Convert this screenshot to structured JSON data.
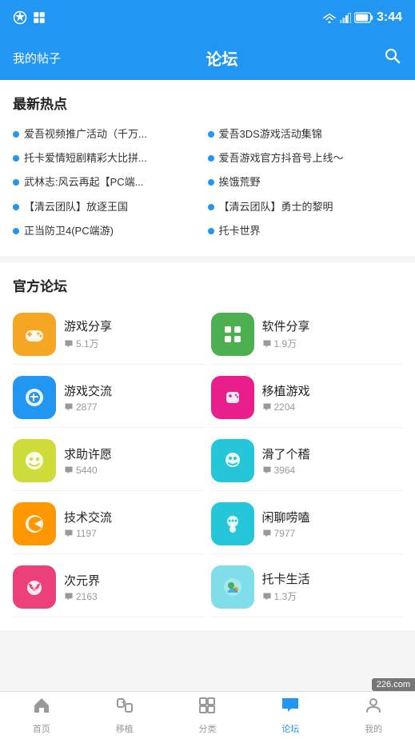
{
  "statusBar": {
    "time": "3:44",
    "icons": [
      "signal",
      "wifi",
      "battery"
    ]
  },
  "navBar": {
    "leftLabel": "我的帖子",
    "title": "论坛",
    "rightIcon": "search"
  },
  "hotSection": {
    "title": "最新热点",
    "items": [
      {
        "text": "爱吾视频推广活动（千万..."
      },
      {
        "text": "爱吾3DS游戏活动集锦"
      },
      {
        "text": "托卡爱情短剧精彩大比拼..."
      },
      {
        "text": "爱吾游戏官方抖音号上线～"
      },
      {
        "text": "武林志:风云再起【PC端..."
      },
      {
        "text": "挨饿荒野"
      },
      {
        "text": "【清云团队】放逐王国"
      },
      {
        "text": "【清云团队】勇士的黎明"
      },
      {
        "text": "正当防卫4(PC端游)"
      },
      {
        "text": "托卡世界"
      }
    ]
  },
  "forumSection": {
    "title": "官方论坛",
    "items": [
      {
        "name": "游戏分享",
        "count": "5.1万",
        "color": "#F5A623",
        "iconType": "gamepad"
      },
      {
        "name": "软件分享",
        "count": "1.9万",
        "color": "#4CAF50",
        "iconType": "grid"
      },
      {
        "name": "游戏交流",
        "count": "2877",
        "color": "#2196F3",
        "iconType": "controller"
      },
      {
        "name": "移植游戏",
        "count": "2204",
        "color": "#E91E8C",
        "iconType": "mobile-game"
      },
      {
        "name": "求助许愿",
        "count": "5440",
        "color": "#CDDC39",
        "iconType": "smile"
      },
      {
        "name": "滑了个稽",
        "count": "3964",
        "color": "#26C6DA",
        "iconType": "ghost"
      },
      {
        "name": "技术交流",
        "count": "1197",
        "color": "#FF9800",
        "iconType": "pacman"
      },
      {
        "name": "闲聊唠嗑",
        "count": "7977",
        "color": "#26C6DA",
        "iconType": "chat-face"
      },
      {
        "name": "次元界",
        "count": "2163",
        "color": "#EC407A",
        "iconType": "fox"
      },
      {
        "name": "托卡生活",
        "count": "1.3万",
        "color": "#80DEEA",
        "iconType": "toca"
      }
    ]
  },
  "tabBar": {
    "tabs": [
      {
        "label": "首页",
        "icon": "home",
        "active": false
      },
      {
        "label": "移植",
        "icon": "transfer",
        "active": false
      },
      {
        "label": "分类",
        "icon": "category",
        "active": false
      },
      {
        "label": "论坛",
        "icon": "forum",
        "active": true
      },
      {
        "label": "我的",
        "icon": "user",
        "active": false
      }
    ]
  },
  "watermark": "226.com"
}
